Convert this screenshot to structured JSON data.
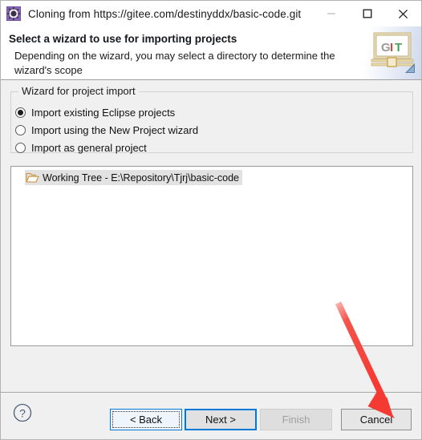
{
  "window": {
    "title": "Cloning from https://gitee.com/destinyddx/basic-code.git",
    "app_icon": "git-repository-icon",
    "controls": {
      "minimize": "minimize-icon",
      "maximize": "maximize-icon",
      "close": "close-icon"
    }
  },
  "header": {
    "title": "Select a wizard to use for importing projects",
    "description": "Depending on the wizard, you may select a directory to determine the wizard's scope",
    "banner_icon": "git-wizard-banner-icon",
    "banner_letters": [
      "G",
      "I",
      "T"
    ]
  },
  "group": {
    "label": "Wizard for project import",
    "options": [
      {
        "label": "Import existing Eclipse projects",
        "selected": true
      },
      {
        "label": "Import using the New Project wizard",
        "selected": false
      },
      {
        "label": "Import as general project",
        "selected": false
      }
    ]
  },
  "tree": {
    "items": [
      {
        "label": "Working Tree - E:\\Repository\\Tjrj\\basic-code",
        "icon": "open-folder-icon",
        "selected": true
      }
    ]
  },
  "footer": {
    "help_icon": "help-question-icon",
    "buttons": [
      {
        "name": "back",
        "label": "< Back",
        "enabled": true,
        "focused": true
      },
      {
        "name": "next",
        "label": "Next >",
        "enabled": true,
        "default": true
      },
      {
        "name": "finish",
        "label": "Finish",
        "enabled": false
      },
      {
        "name": "cancel",
        "label": "Cancel",
        "enabled": true
      }
    ]
  },
  "annotation": {
    "type": "arrow",
    "color": "#f43a32",
    "points_to": "cancel-button"
  },
  "colors": {
    "accent": "#0078d7",
    "dialog_bg": "#f0f0f0",
    "header_bg": "#ffffff",
    "selection": "#e2e2e2",
    "annotation_red": "#f43a32"
  }
}
